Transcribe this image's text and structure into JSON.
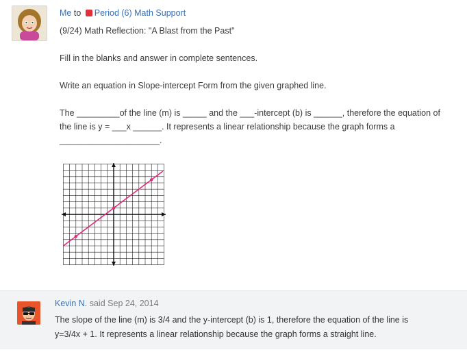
{
  "post": {
    "author": "Me",
    "to_word": "to",
    "group_name": "Period (6) Math Support",
    "title": "(9/24) Math Reflection: \"A Blast from the Past\"",
    "instructions": "Fill in the blanks and answer in complete sentences.",
    "task": "Write an equation in Slope-intercept Form from the given graphed line.",
    "fill_line1": "The _________of the line (m) is _____ and the ___-intercept (b) is ______, therefore the equation of",
    "fill_line2": "the line is y = ___x ______. It represents a linear relationship because the graph forms a",
    "fill_line3": "_____________________."
  },
  "graph": {
    "line_color": "#e0297a",
    "slope": 0.75,
    "intercept": 1
  },
  "reply": {
    "author": "Kevin N.",
    "said_label": "said",
    "date": "Sep 24, 2014",
    "text_line1": "The slope of the line (m) is 3/4 and the y-intercept (b) is 1, therefore the equation of the line is",
    "text_line2": "y=3/4x + 1. It represents a linear relationship because the graph forms a straight line."
  },
  "colors": {
    "link": "#3a6fb0",
    "group_dot": "#e0303a",
    "reply_bg": "#f2f3f5"
  }
}
